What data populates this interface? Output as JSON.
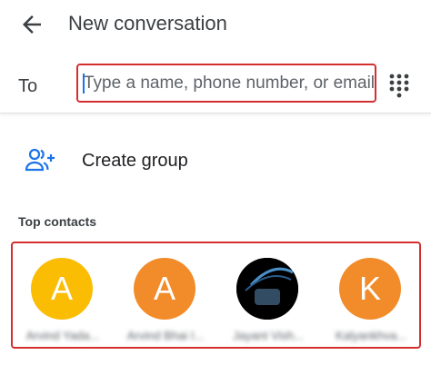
{
  "header": {
    "title": "New conversation",
    "back_icon": "arrow-back-icon"
  },
  "recipient": {
    "label": "To",
    "placeholder": "Type a name, phone number, or email",
    "dialpad_icon": "dialpad-icon"
  },
  "create_group": {
    "label": "Create group",
    "icon": "add-group-icon"
  },
  "top_contacts": {
    "label": "Top contacts",
    "items": [
      {
        "initial": "A",
        "color": "#fbbc04",
        "name": "Arvind Yada..."
      },
      {
        "initial": "A",
        "color": "#f28b29",
        "name": "Arvind Bhai I..."
      },
      {
        "initial": "",
        "color": "#000000",
        "name": "Jayant Vish..."
      },
      {
        "initial": "K",
        "color": "#f28b29",
        "name": "Kalyankhva..."
      }
    ]
  },
  "colors": {
    "accent": "#1a73e8",
    "highlight": "#d32f2f"
  }
}
